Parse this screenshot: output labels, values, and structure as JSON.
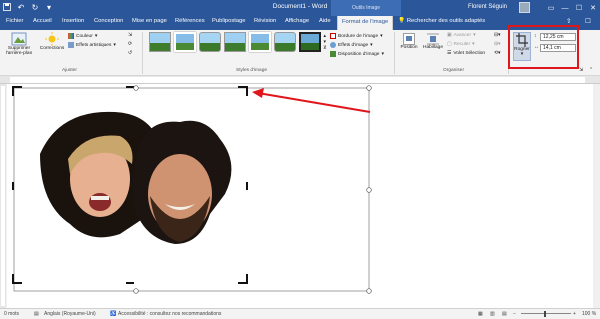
{
  "window": {
    "title": "Document1 - Word",
    "context_tab_label": "Outils Image",
    "user_name": "Florent Séguin"
  },
  "tabs": [
    {
      "label": "Fichier"
    },
    {
      "label": "Accueil"
    },
    {
      "label": "Insertion"
    },
    {
      "label": "Conception"
    },
    {
      "label": "Mise en page"
    },
    {
      "label": "Références"
    },
    {
      "label": "Publipostage"
    },
    {
      "label": "Révision"
    },
    {
      "label": "Affichage"
    },
    {
      "label": "Aide"
    },
    {
      "label": "Format de l'image"
    }
  ],
  "search": {
    "label": "Rechercher des outils adaptés"
  },
  "ribbon": {
    "remove_bg": "Supprimer l'arrière-plan",
    "corrections": "Corrections",
    "color": "Couleur",
    "artistic_effects": "Effets artistiques",
    "adjust_group": "Ajuster",
    "styles_group": "Styles d'image",
    "border": "Bordure de l'image",
    "effects": "Effets d'image",
    "layout": "Disposition d'image",
    "position": "Position",
    "wrap": "Habillage",
    "forward": "Avancer",
    "backward": "Reculer",
    "selection_pane": "Volet Sélection",
    "arrange_group": "Organiser",
    "crop": "Rogner",
    "height": "12,25 cm",
    "width": "14,1 cm"
  },
  "status": {
    "words": "0 mots",
    "language": "Anglais (Royaume-Uni)",
    "accessibility": "Accessibilité : consultez nos recommandations",
    "zoom": "100 %"
  },
  "colors": {
    "brand_blue": "#2b579a",
    "highlight_red": "#e0161d",
    "crop_handle": "#111111"
  }
}
